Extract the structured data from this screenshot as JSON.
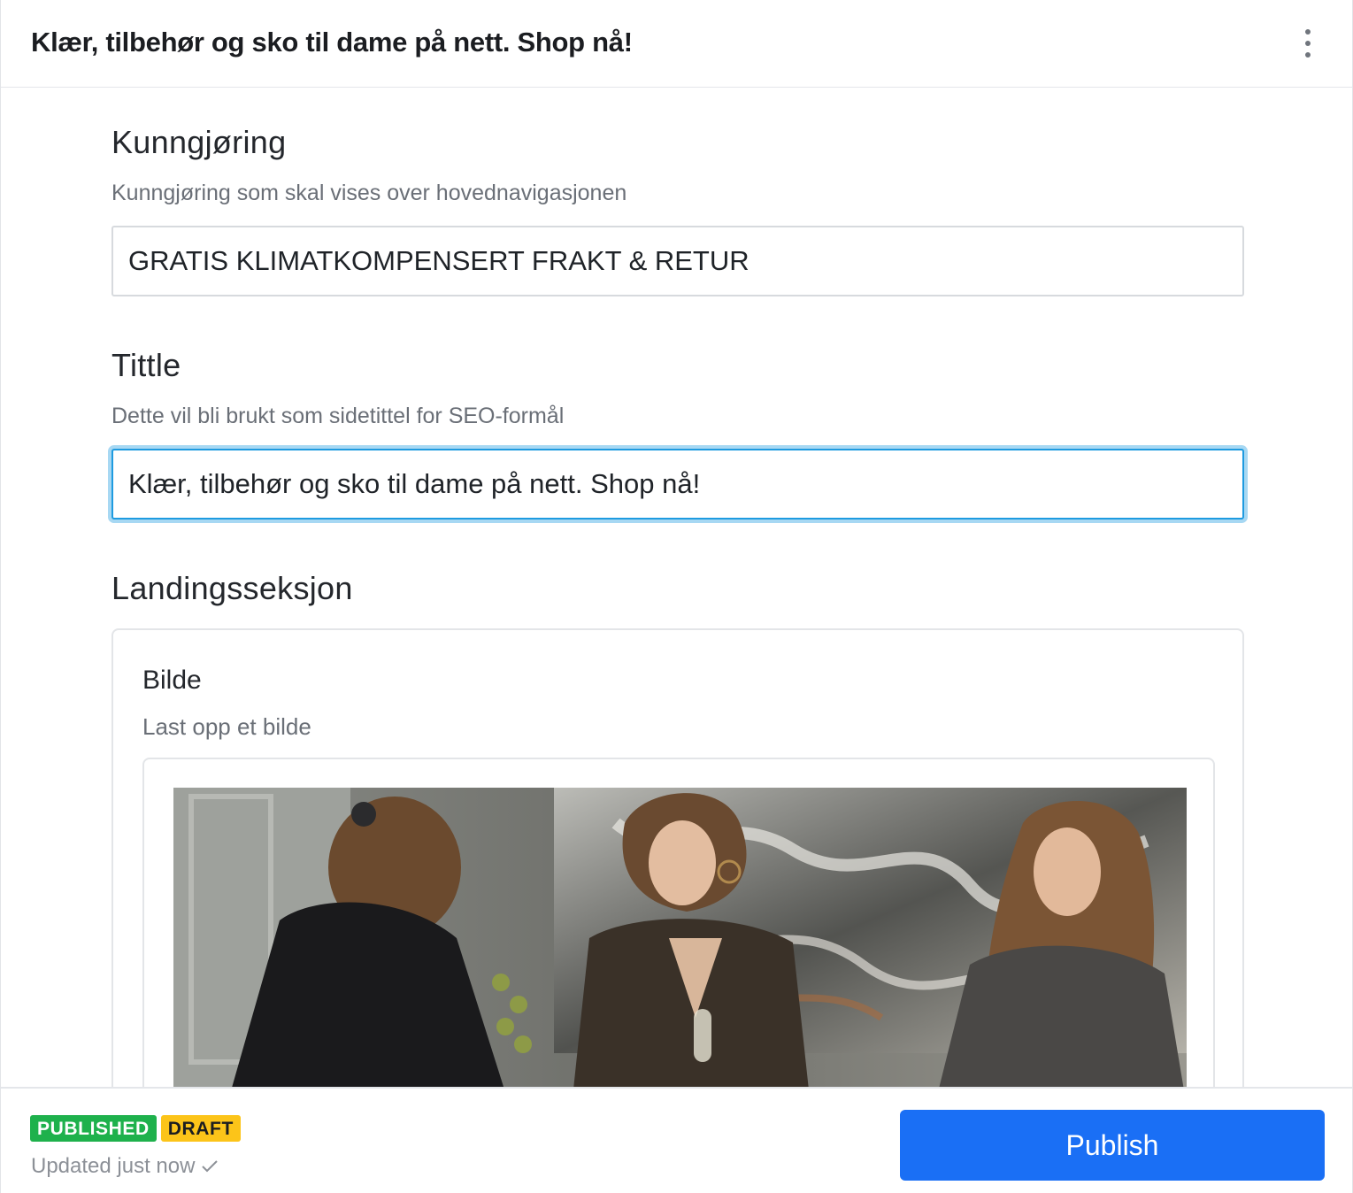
{
  "header": {
    "title": "Klær, tilbehør og sko til dame på nett. Shop nå!",
    "menu_icon": "more-vertical-icon"
  },
  "fields": {
    "announcement": {
      "title": "Kunngjøring",
      "description": "Kunngjøring som skal vises over hovednavigasjonen",
      "value": "GRATIS KLIMATKOMPENSERT FRAKT & RETUR"
    },
    "title_field": {
      "title": "Tittle",
      "description": "Dette vil bli brukt som sidetittel for SEO-formål",
      "value": "Klær, tilbehør og sko til dame på nett. Shop nå!"
    }
  },
  "landing": {
    "title": "Landingsseksjon",
    "image": {
      "title": "Bilde",
      "description": "Last opp et bilde"
    }
  },
  "footer": {
    "badges": [
      "PUBLISHED",
      "DRAFT"
    ],
    "status_text": "Updated just now",
    "status_icon": "checkmark-icon",
    "publish_label": "Publish"
  },
  "colors": {
    "published": "#1eb14c",
    "draft": "#fcc419",
    "primary": "#1a6ff5",
    "focus": "#1e9be0"
  }
}
